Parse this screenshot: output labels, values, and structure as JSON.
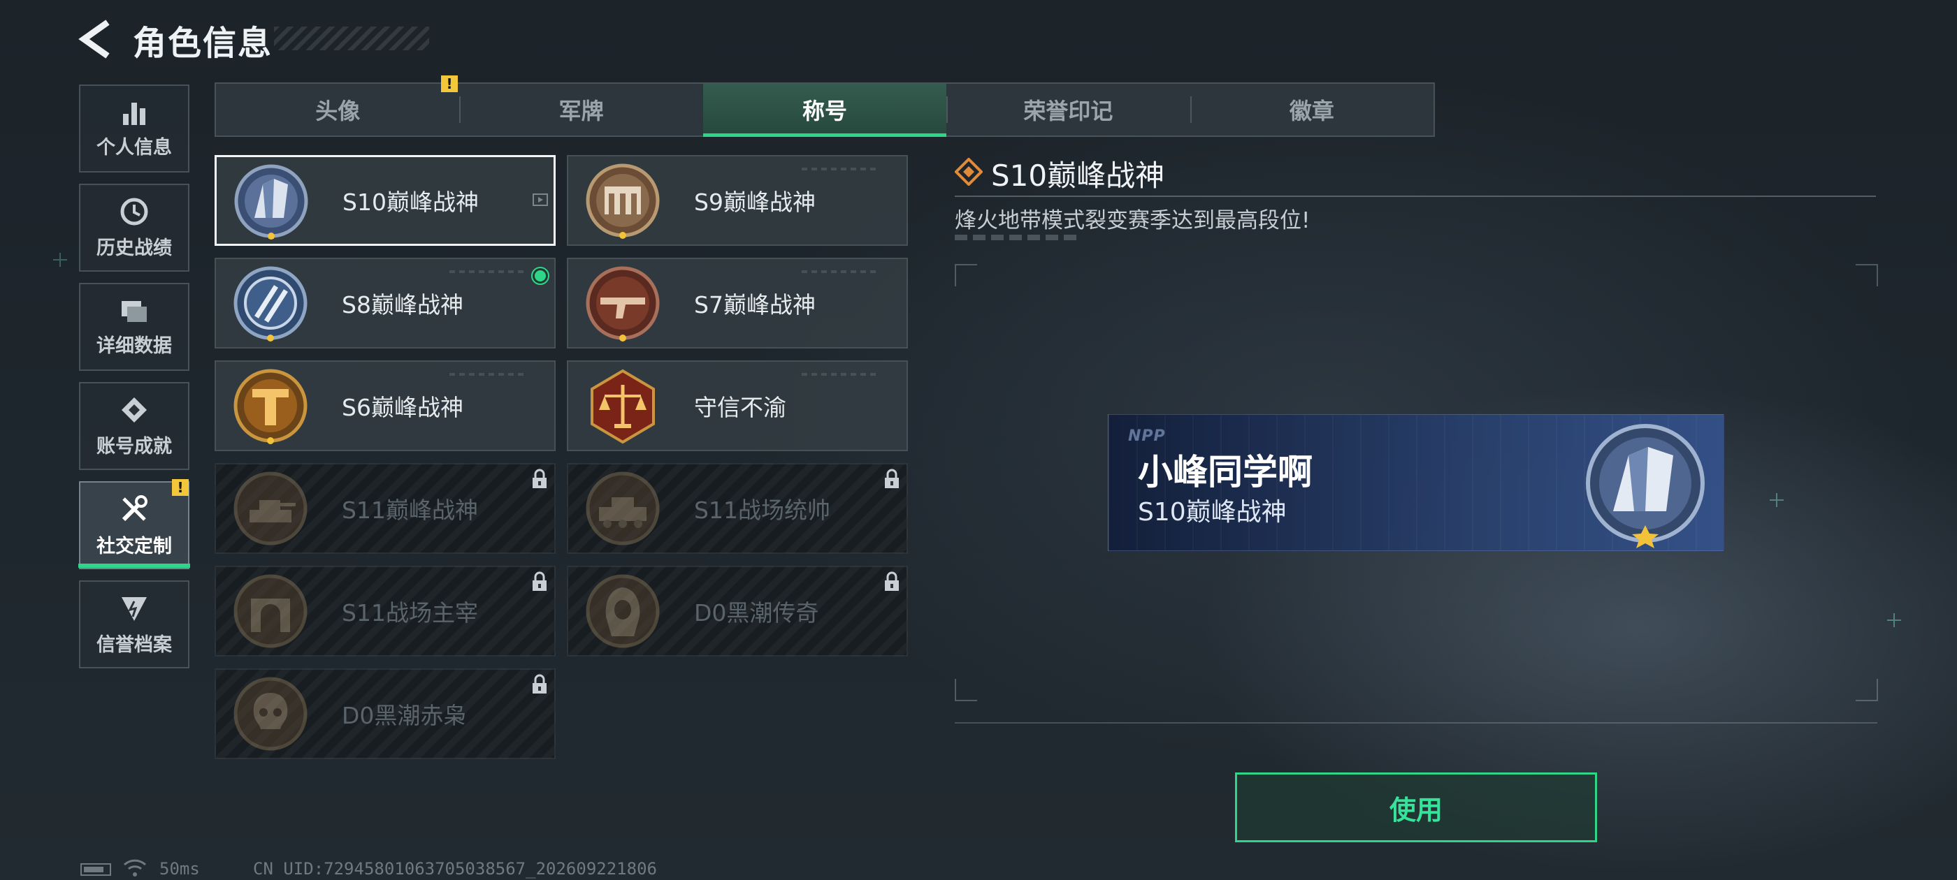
{
  "header": {
    "title": "角色信息"
  },
  "sidebar": {
    "items": [
      {
        "label": "个人信息",
        "icon": "bar-chart-icon"
      },
      {
        "label": "历史战绩",
        "icon": "clock-icon"
      },
      {
        "label": "详细数据",
        "icon": "folder-icon"
      },
      {
        "label": "账号成就",
        "icon": "achievement-icon"
      },
      {
        "label": "社交定制",
        "icon": "tools-icon",
        "active": true,
        "badge": "!"
      },
      {
        "label": "信誉档案",
        "icon": "shield-icon"
      }
    ]
  },
  "tabs": [
    {
      "label": "头像",
      "badge": "!"
    },
    {
      "label": "军牌"
    },
    {
      "label": "称号",
      "active": true
    },
    {
      "label": "荣誉印记"
    },
    {
      "label": "徽章"
    }
  ],
  "titles": [
    {
      "name": "S10巅峰战神",
      "locked": false,
      "selected": true
    },
    {
      "name": "S9巅峰战神",
      "locked": false
    },
    {
      "name": "S8巅峰战神",
      "locked": false,
      "equipped": true
    },
    {
      "name": "S7巅峰战神",
      "locked": false
    },
    {
      "name": "S6巅峰战神",
      "locked": false
    },
    {
      "name": "守信不渝",
      "locked": false
    },
    {
      "name": "S11巅峰战神",
      "locked": true
    },
    {
      "name": "S11战场统帅",
      "locked": true
    },
    {
      "name": "S11战场主宰",
      "locked": true
    },
    {
      "name": "D0黑潮传奇",
      "locked": true
    },
    {
      "name": "D0黑潮赤枭",
      "locked": true
    }
  ],
  "detail": {
    "title": "S10巅峰战神",
    "description": "烽火地带模式裂变赛季达到最高段位!"
  },
  "nameplate": {
    "logo": "NPP",
    "player_name": "小峰同学啊",
    "title": "S10巅峰战神"
  },
  "use_button": {
    "label": "使用"
  },
  "status_bar": {
    "ping": "50ms",
    "uid": "CN UID:72945801063705038567_202609221806"
  },
  "colors": {
    "accent": "#2fd68a",
    "warning": "#f3c73a",
    "detail_icon": "#e08a3a"
  }
}
